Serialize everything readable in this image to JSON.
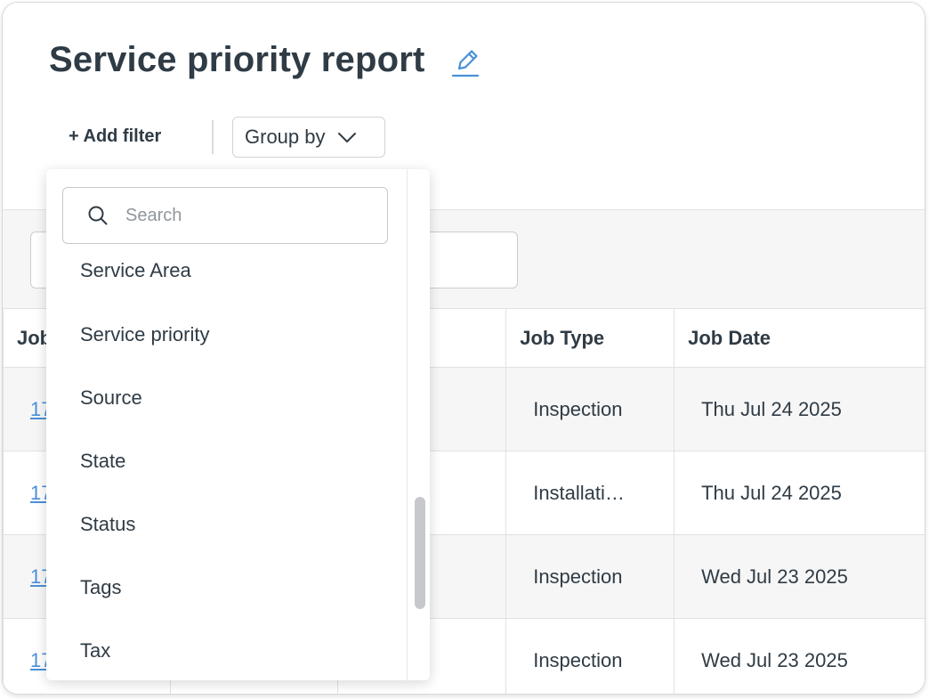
{
  "header": {
    "title": "Service priority report",
    "add_filter_label": "+ Add filter",
    "group_by_label": "Group by"
  },
  "icons": {
    "edit": "pencil-icon",
    "chevron": "chevron-down-icon",
    "search": "search-icon"
  },
  "colors": {
    "accent": "#4a90d9",
    "text": "#2f3b45",
    "body_bg": "#f6f6f6"
  },
  "table": {
    "columns": [
      "Job",
      "",
      "",
      "Job Type",
      "Job Date"
    ],
    "rows": [
      {
        "job": "17",
        "type": "Inspection",
        "date": "Thu Jul 24 2025"
      },
      {
        "job": "17",
        "type": "Installati…",
        "date": "Thu Jul 24 2025"
      },
      {
        "job": "17",
        "type": "Inspection",
        "date": "Wed Jul 23 2025"
      },
      {
        "job": "17",
        "type": "Inspection",
        "date": "Wed Jul 23 2025"
      }
    ]
  },
  "dropdown": {
    "search_placeholder": "Search",
    "items": [
      "Service Area",
      "Service priority",
      "Source",
      "State",
      "Status",
      "Tags",
      "Tax"
    ]
  }
}
